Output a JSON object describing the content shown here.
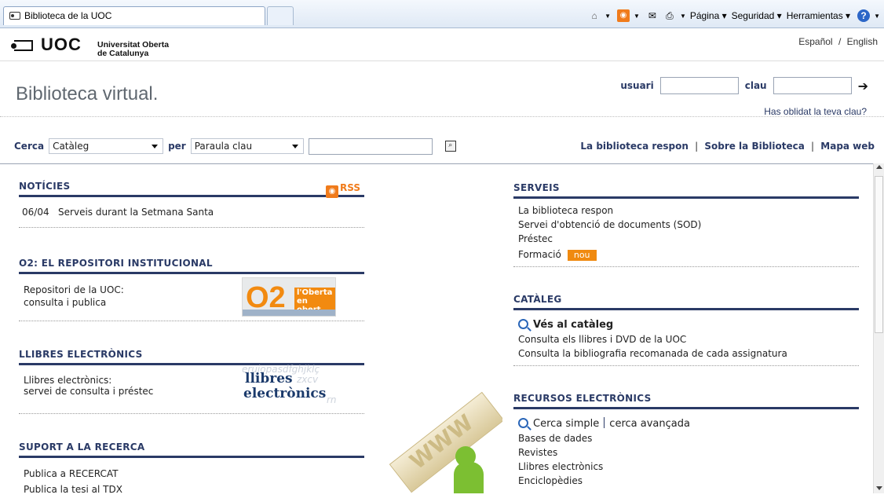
{
  "browser": {
    "tab_title": "Biblioteca de la UOC",
    "commands": {
      "page": "Página",
      "security": "Seguridad",
      "tools": "Herramientas"
    },
    "icons": [
      "home-icon",
      "rss-feed-icon",
      "mail-icon",
      "print-icon",
      "help-icon"
    ]
  },
  "header": {
    "logo": "UOC",
    "logo_sub_1": "Universitat Oberta",
    "logo_sub_2": "de Catalunya",
    "lang_es": "Español",
    "lang_sep": "/",
    "lang_en": "English"
  },
  "site": {
    "title": "Biblioteca virtual."
  },
  "login": {
    "user_label": "usuari",
    "pass_label": "clau",
    "forgot": "Has oblidat la teva clau?"
  },
  "search": {
    "label": "Cerca",
    "scope_value": "Catàleg",
    "per_label": "per",
    "field_value": "Paraula clau",
    "query_value": ""
  },
  "toplinks": {
    "link1": "La biblioteca respon",
    "sep": "|",
    "link2": "Sobre la Biblioteca",
    "link3": "Mapa web"
  },
  "left": {
    "noticies": {
      "title": "NOTÍCIES",
      "rss": "RSS",
      "item_date": "06/04",
      "item_text": "Serveis durant la Setmana Santa"
    },
    "repositori": {
      "title": "O2: EL REPOSITORI INSTITUCIONAL",
      "line1": "Repositori de la UOC:",
      "line2": "consulta i publica",
      "img_big": "O2",
      "img_tag1": "l'Oberta",
      "img_tag2": "en obert"
    },
    "llibres": {
      "title": "LLIBRES ELECTRÒNICS",
      "line1": "Llibres electrònics:",
      "line2": "servei de consulta i préstec",
      "img_l1": "llibres",
      "img_l2": "electrònics",
      "img_bg1": "eruiopasdfghjklç",
      "img_bg2": "zxcv",
      "img_bg3": "rn"
    },
    "suport": {
      "title": "SUPORT A LA RECERCA",
      "item1": "Publica a RECERCAT",
      "item2": "Publica la tesi al TDX"
    }
  },
  "right": {
    "serveis": {
      "title": "SERVEIS",
      "items": [
        "La biblioteca respon",
        "Servei d'obtenció de documents (SOD)",
        "Préstec",
        "Formació"
      ],
      "badge": "nou"
    },
    "cataleg": {
      "title": "CATÀLEG",
      "main_link": "Vés al catàleg",
      "items": [
        "Consulta els llibres i DVD de la UOC",
        "Consulta la bibliografia recomanada de cada assignatura"
      ]
    },
    "recursos": {
      "title": "RECURSOS ELECTRÒNICS",
      "simple": "Cerca simple",
      "advanced": "cerca avançada",
      "items": [
        "Bases de dades",
        "Revistes",
        "Llibres electrònics",
        "Enciclopèdies"
      ]
    }
  },
  "decoration": {
    "www": "WWW"
  }
}
